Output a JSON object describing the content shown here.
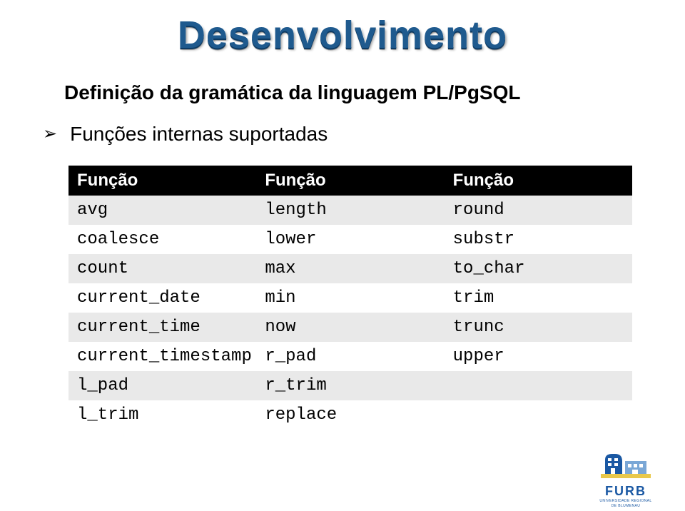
{
  "title": "Desenvolvimento",
  "subtitle": "Definição da gramática da linguagem PL/PgSQL",
  "bullet": "Funções internas suportadas",
  "table": {
    "headers": [
      "Função",
      "Função",
      "Função"
    ],
    "rows": [
      [
        "avg",
        "length",
        "round"
      ],
      [
        "coalesce",
        "lower",
        "substr"
      ],
      [
        "count",
        "max",
        "to_char"
      ],
      [
        "current_date",
        "min",
        "trim"
      ],
      [
        "current_time",
        "now",
        "trunc"
      ],
      [
        "current_timestamp",
        "r_pad",
        "upper"
      ],
      [
        "l_pad",
        "r_trim",
        ""
      ],
      [
        "l_trim",
        "replace",
        ""
      ]
    ]
  },
  "logo": {
    "name": "FURB",
    "subline1": "UNIVERSIDADE REGIONAL",
    "subline2": "DE BLUMENAU"
  }
}
